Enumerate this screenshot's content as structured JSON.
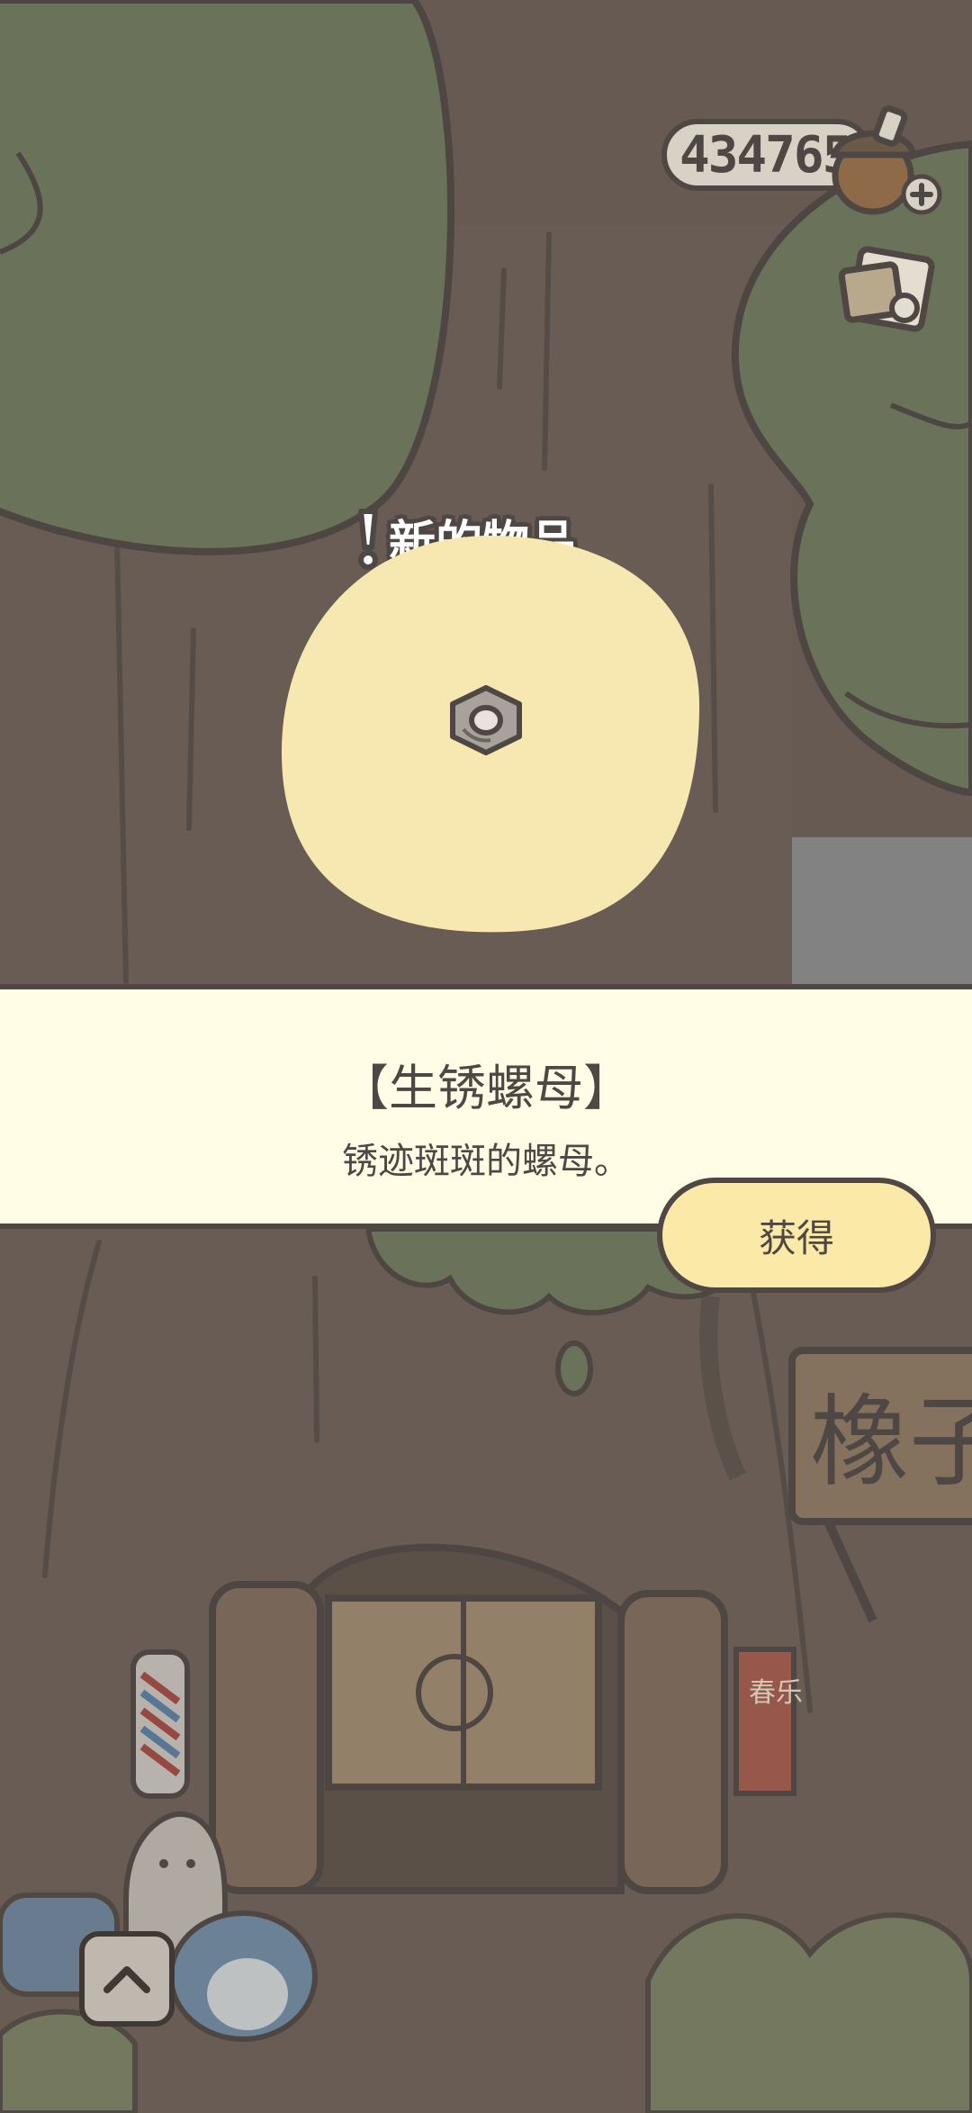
{
  "currency": {
    "amount": "434765"
  },
  "notification": {
    "label": "新的物品"
  },
  "item": {
    "name": "【生锈螺母】",
    "description": "锈迹斑斑的螺母。"
  },
  "actions": {
    "obtain_label": "获得"
  },
  "icons": {
    "currency": "acorn-icon",
    "add": "plus-icon",
    "mail": "postcard-icon",
    "item": "rusty-nut-icon",
    "expand": "chevron-up-icon"
  },
  "colors": {
    "outline": "#4f4744",
    "banner": "#fffde6",
    "button": "#fbe9a8",
    "tree": "#6f7a5e",
    "bark": "#6e6058"
  },
  "shop_sign": {
    "text": "橡子"
  },
  "scroll_sign": {
    "text": "春乐"
  }
}
